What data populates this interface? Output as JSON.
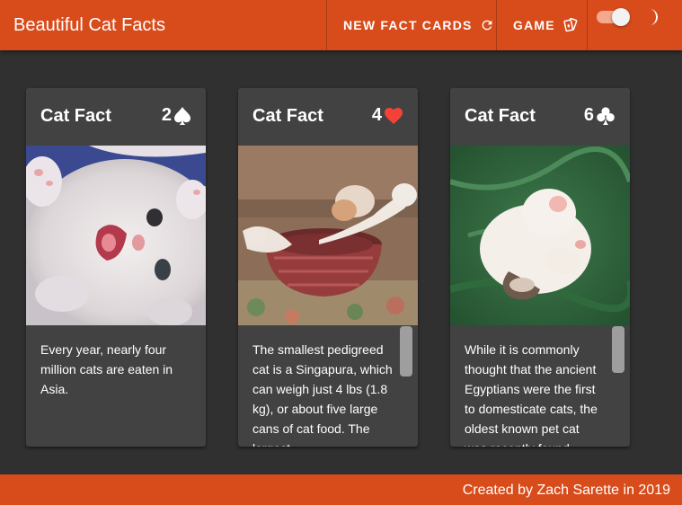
{
  "app": {
    "title": "Beautiful Cat Facts",
    "accent_color": "#d84c1c",
    "background_color": "#303030",
    "card_color": "#424242"
  },
  "nav": {
    "new_cards_label": "NEW FACT CARDS",
    "new_cards_icon": "refresh-icon",
    "game_label": "GAME",
    "game_icon": "playing-cards-icon"
  },
  "theme": {
    "dark_mode_on": true,
    "toggle_icon": "moon-icon"
  },
  "cards": [
    {
      "title": "Cat Fact",
      "rank": "2",
      "suit": "spade",
      "suit_color": "#ffffff",
      "image": "white kitten lying on its back",
      "text": "Every year, nearly four million cats are eaten in Asia."
    },
    {
      "title": "Cat Fact",
      "rank": "4",
      "suit": "heart",
      "suit_color": "#f44336",
      "image": "kittens climbing out of a woven basket",
      "text": "The smallest pedigreed cat is a Singapura, which can weigh just 4 lbs (1.8 kg), or about five large cans of cat food. The largest"
    },
    {
      "title": "Cat Fact",
      "rank": "6",
      "suit": "club",
      "suit_color": "#ffffff",
      "image": "white kitten curled up asleep on a green blanket",
      "text": "While it is commonly thought that the ancient Egyptians were the first to domesticate cats, the oldest known pet cat was recently found"
    }
  ],
  "footer": {
    "credit": "Created by Zach Sarette in 2019"
  }
}
